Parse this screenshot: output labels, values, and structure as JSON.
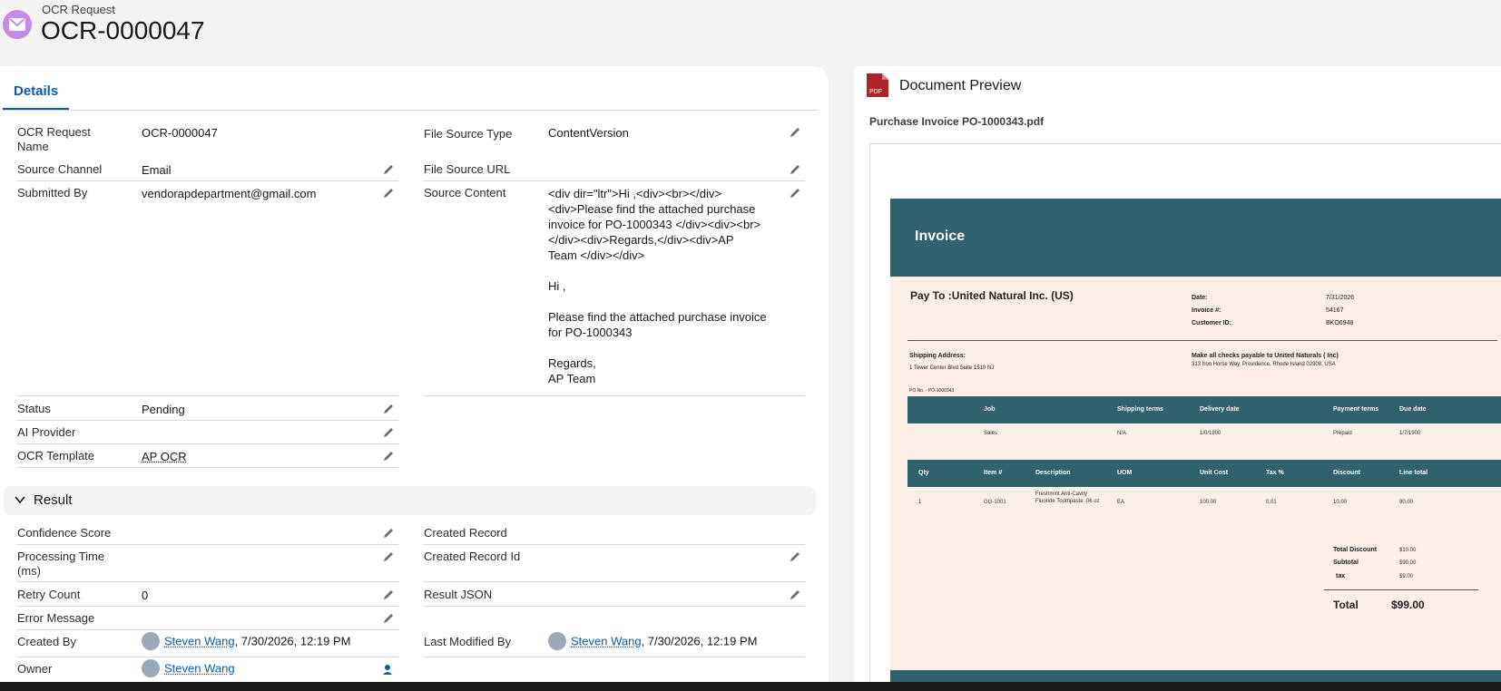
{
  "header": {
    "object_type": "OCR Request",
    "record_name": "OCR-0000047"
  },
  "tabs": [
    {
      "label": "Details"
    }
  ],
  "details": {
    "ocr_request_name": {
      "label": "OCR Request Name",
      "value": "OCR-0000047"
    },
    "source_channel": {
      "label": "Source Channel",
      "value": "Email"
    },
    "submitted_by": {
      "label": "Submitted By",
      "value": "vendorapdepartment@gmail.com"
    },
    "status": {
      "label": "Status",
      "value": "Pending"
    },
    "ai_provider": {
      "label": "AI Provider",
      "value": ""
    },
    "ocr_template": {
      "label": "OCR Template",
      "value": "AP OCR"
    },
    "file_source_type": {
      "label": "File Source Type",
      "value": "ContentVersion"
    },
    "file_source_url": {
      "label": "File Source URL",
      "value": ""
    },
    "source_content": {
      "label": "Source Content",
      "lines": [
        "<div dir=\"ltr\">Hi ,<div><br></div>",
        "<div>Please find the attached purchase",
        "invoice for PO-1000343 </div><div><br>",
        "</div><div>Regards,</div><div>AP",
        "Team </div></div>",
        "",
        "Hi ,",
        "",
        "Please find the attached purchase invoice",
        "for PO-1000343",
        "",
        "Regards,",
        "AP Team"
      ]
    }
  },
  "result": {
    "section_label": "Result",
    "confidence_score": {
      "label": "Confidence Score",
      "value": ""
    },
    "processing_time": {
      "label": "Processing Time (ms)",
      "value": ""
    },
    "retry_count": {
      "label": "Retry Count",
      "value": "0"
    },
    "error_message": {
      "label": "Error Message",
      "value": ""
    },
    "created_by": {
      "label": "Created By",
      "user": "Steven Wang",
      "date": ", 7/30/2026, 12:19 PM"
    },
    "owner": {
      "label": "Owner",
      "user": "Steven Wang"
    },
    "created_record": {
      "label": "Created Record",
      "value": ""
    },
    "created_record_id": {
      "label": "Created Record Id",
      "value": ""
    },
    "result_json": {
      "label": "Result JSON",
      "value": ""
    },
    "last_modified_by": {
      "label": "Last Modified By",
      "user": "Steven Wang",
      "date": ", 7/30/2026, 12:19 PM"
    }
  },
  "preview": {
    "title": "Document Preview",
    "file_name": "Purchase Invoice PO-1000343.pdf",
    "pdf_badge": "PDF",
    "invoice": {
      "heading": "Invoice",
      "pay_to": "Pay To  :United Natural Inc. (US)",
      "date_label": "Date:",
      "date_value": "7/31/2026",
      "invoice_no_label": "Invoice #:",
      "invoice_no_value": "54167",
      "customer_id_label": "Customer ID:",
      "customer_id_value": "BKO6948",
      "shipping_label": "Shipping Address:",
      "shipping_value": "1 Tower Center Blvd Suite 1510 NJ",
      "checks_label": "Make all checks payable to United Naturals ( Inc)",
      "checks_value": "313 Iron Horse Way, Providence, Rhode Island 02908, USA",
      "po_no": "PO No. - PO-1000343",
      "job_headers": [
        "Job",
        "Shipping terms",
        "Delivery date",
        "Payment terms",
        "Due date"
      ],
      "job_row": [
        "Sales",
        "N/A",
        "1/0/1900",
        "Prepaid",
        "1/7/1900"
      ],
      "item_headers": [
        "Qty",
        "Item #",
        "Description",
        "UOM",
        "Unit Cost",
        "Tax %",
        "Discount",
        "Line total"
      ],
      "item_row": [
        "1",
        "GG-1001",
        "Freshmint Anti-Cavity Fluoride Toothpaste .06 oz",
        "EA",
        "100.00",
        "0.01",
        "10.00",
        "90.00"
      ],
      "total_discount_label": "Total Discount",
      "total_discount_value": "$10.00",
      "subtotal_label": "Subtotal",
      "subtotal_value": "$90.00",
      "tax_label": "tax",
      "tax_value": "$9.00",
      "total_label": "Total",
      "total_value": "$99.00"
    }
  }
}
